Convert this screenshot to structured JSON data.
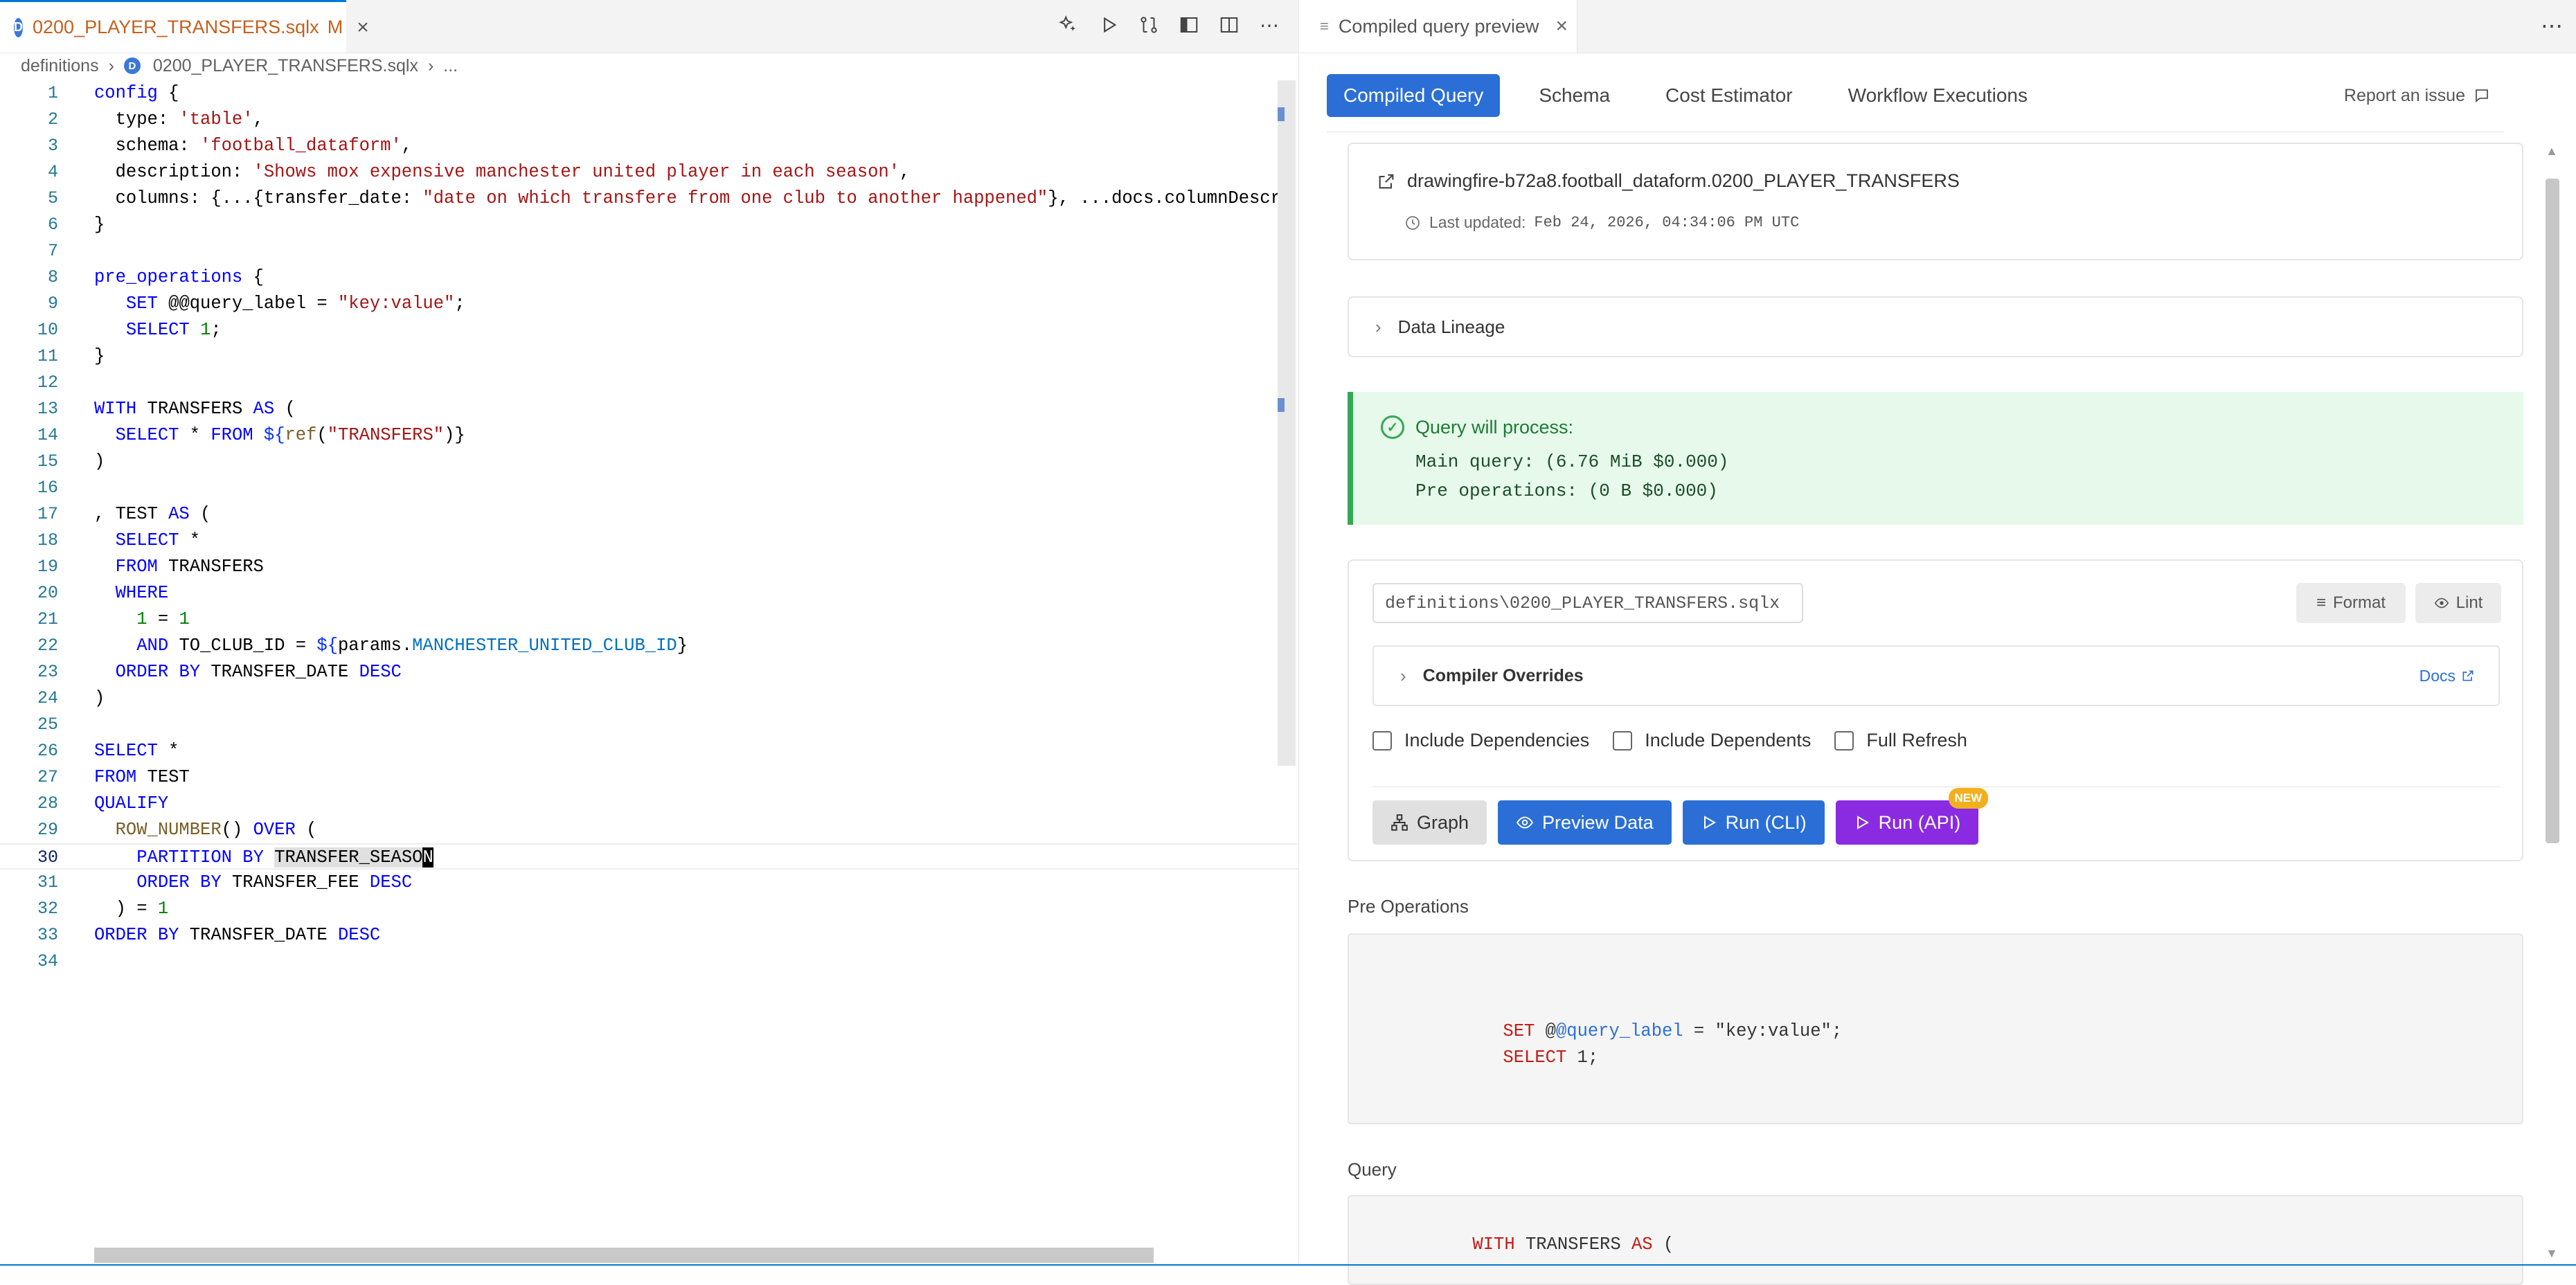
{
  "editor": {
    "tab": {
      "icon": "D",
      "name": "0200_PLAYER_TRANSFERS.sqlx",
      "modified": "M"
    },
    "breadcrumb": {
      "folder": "definitions",
      "file": "0200_PLAYER_TRANSFERS.sqlx",
      "more": "..."
    },
    "lines": [
      {
        "n": "1",
        "code": "config {"
      },
      {
        "n": "2",
        "code": "  type: 'table',"
      },
      {
        "n": "3",
        "code": "  schema: 'football_dataform',"
      },
      {
        "n": "4",
        "code": "  description: 'Shows mox expensive manchester united player in each season',"
      },
      {
        "n": "5",
        "code": "  columns: {...{transfer_date: \"date on which transfere from one club to another happened\"}, ...docs.columnDescri"
      },
      {
        "n": "6",
        "code": "}"
      },
      {
        "n": "7",
        "code": ""
      },
      {
        "n": "8",
        "code": "pre_operations {"
      },
      {
        "n": "9",
        "code": "   SET @@query_label = \"key:value\";"
      },
      {
        "n": "10",
        "code": "   SELECT 1;"
      },
      {
        "n": "11",
        "code": "}"
      },
      {
        "n": "12",
        "code": ""
      },
      {
        "n": "13",
        "code": "WITH TRANSFERS AS ("
      },
      {
        "n": "14",
        "code": "  SELECT * FROM ${ref(\"TRANSFERS\")}"
      },
      {
        "n": "15",
        "code": ")"
      },
      {
        "n": "16",
        "code": ""
      },
      {
        "n": "17",
        "code": ", TEST AS ("
      },
      {
        "n": "18",
        "code": "  SELECT *"
      },
      {
        "n": "19",
        "code": "  FROM TRANSFERS"
      },
      {
        "n": "20",
        "code": "  WHERE"
      },
      {
        "n": "21",
        "code": "    1 = 1"
      },
      {
        "n": "22",
        "code": "    AND TO_CLUB_ID = ${params.MANCHESTER_UNITED_CLUB_ID}"
      },
      {
        "n": "23",
        "code": "  ORDER BY TRANSFER_DATE DESC"
      },
      {
        "n": "24",
        "code": ")"
      },
      {
        "n": "25",
        "code": ""
      },
      {
        "n": "26",
        "code": "SELECT *"
      },
      {
        "n": "27",
        "code": "FROM TEST"
      },
      {
        "n": "28",
        "code": "QUALIFY"
      },
      {
        "n": "29",
        "code": "  ROW_NUMBER() OVER ("
      },
      {
        "n": "30",
        "code": "    PARTITION BY TRANSFER_SEASON"
      },
      {
        "n": "31",
        "code": "    ORDER BY TRANSFER_FEE DESC"
      },
      {
        "n": "32",
        "code": "  ) = 1"
      },
      {
        "n": "33",
        "code": "ORDER BY TRANSFER_DATE DESC"
      },
      {
        "n": "34",
        "code": ""
      }
    ]
  },
  "panel": {
    "tab": {
      "name": "Compiled query preview"
    },
    "nav": [
      "Compiled Query",
      "Schema",
      "Cost Estimator",
      "Workflow Executions"
    ],
    "report": "Report an issue",
    "table_ref": "drawingfire-b72a8.football_dataform.0200_PLAYER_TRANSFERS",
    "last_updated_label": "Last updated:",
    "last_updated_value": "Feb 24, 2026, 04:34:06 PM UTC",
    "lineage": "Data Lineage",
    "process": {
      "title": "Query will process:",
      "main": "Main query: (6.76 MiB $0.000)",
      "pre": "Pre operations: (0 B $0.000)"
    },
    "file_path": "definitions\\0200_PLAYER_TRANSFERS.sqlx",
    "format": "Format",
    "lint": "Lint",
    "overrides": "Compiler Overrides",
    "docs": "Docs",
    "checks": [
      "Include Dependencies",
      "Include Dependents",
      "Full Refresh"
    ],
    "buttons": {
      "graph": "Graph",
      "preview": "Preview Data",
      "run_cli": "Run (CLI)",
      "run_api": "Run (API)",
      "new": "NEW"
    },
    "pre_ops_label": "Pre Operations",
    "pre_ops": {
      "line1_kw": "SET",
      "line1_at": "@",
      "line1_var": "@query_label",
      "line1_rest": " = \"key:value\";",
      "line2_kw": "SELECT",
      "line2_rest": " 1;"
    },
    "query_label": "Query",
    "query_first": {
      "kw1": "WITH",
      "mid": " TRANSFERS ",
      "kw2": "AS",
      "rest": " ("
    }
  },
  "colors": {
    "accent": "#2b6fd6",
    "success": "#34a853",
    "run_api": "#8a2be2",
    "badge": "#f2b01e",
    "tab_modified": "#c2611f"
  }
}
